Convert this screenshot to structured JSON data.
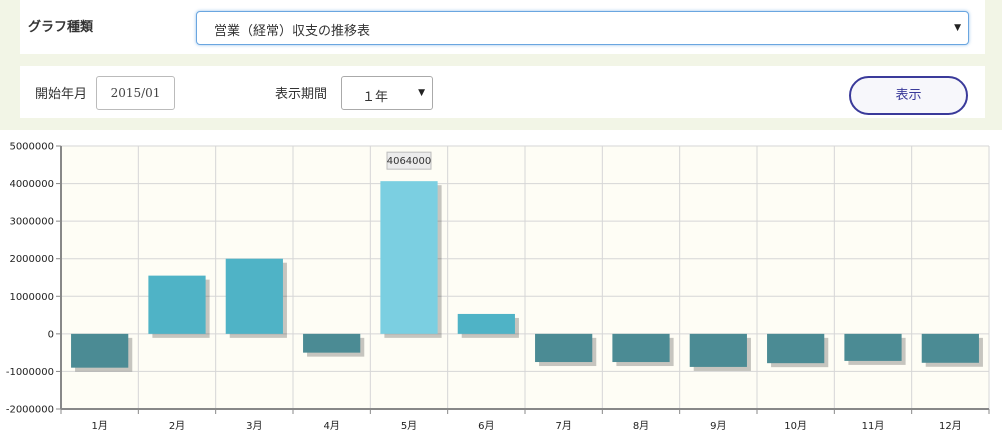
{
  "controls": {
    "graph_type_label": "グラフ種類",
    "graph_type_value": "営業（経常）収支の推移表",
    "start_label": "開始年月",
    "start_value": "2015/01",
    "period_label": "表示期間",
    "period_value": "１年",
    "show_label": "表示"
  },
  "colors": {
    "positive": "#4fb3c6",
    "negative": "#4b8b94",
    "highlight": "#7bcfe1",
    "plot_bg": "#fefdf5",
    "grid": "#d6d6d6"
  },
  "chart_data": {
    "type": "bar",
    "categories": [
      "1月",
      "2月",
      "3月",
      "4月",
      "5月",
      "6月",
      "7月",
      "8月",
      "9月",
      "10月",
      "11月",
      "12月"
    ],
    "values": [
      -900000,
      1550000,
      2000000,
      -500000,
      4064000,
      530000,
      -750000,
      -750000,
      -880000,
      -780000,
      -720000,
      -770000
    ],
    "ylim": [
      -2000000,
      5000000
    ],
    "yticks": [
      "5000000",
      "4000000",
      "3000000",
      "2000000",
      "1000000",
      "0",
      "-1000000",
      "-2000000"
    ],
    "tooltip": "4064000",
    "highlight_index": 4,
    "grid": true
  }
}
